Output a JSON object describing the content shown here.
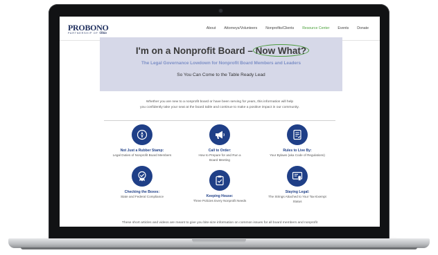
{
  "site": {
    "logo": {
      "main_pro": "PRO",
      "main_bono": "BONO",
      "sub": "PARTNERSHIP OF",
      "sub_ohio": "Ohio"
    },
    "nav": [
      {
        "label": "About"
      },
      {
        "label": "Attorneys/Volunteers"
      },
      {
        "label": "Nonprofits/Clients"
      },
      {
        "label": "Resource Center",
        "active": true
      },
      {
        "label": "Events"
      },
      {
        "label": "Donate"
      }
    ]
  },
  "hero": {
    "title_prefix": "I'm on a Nonprofit Board – ",
    "title_highlight": "Now What?",
    "subtitle": "The Legal Governance Lowdown for Nonprofit Board Members and Leaders",
    "tagline": "So You Can Come to the Table Ready Lead"
  },
  "intro": {
    "line1": "Whether you are new to a nonprofit board or have been serving for years, this information will help",
    "line2": "you confidently take your seat at the board table and continue to make a positive impact in our community."
  },
  "cards": [
    {
      "icon": "compass-icon",
      "title": "Not Just a Rubber Stamp:",
      "desc": "Legal Duties of Nonprofit Board Members"
    },
    {
      "icon": "megaphone-icon",
      "title": "Call to Order:",
      "desc": "How to Prepare for and Run a Board Meeting"
    },
    {
      "icon": "document-icon",
      "title": "Rules to Live By:",
      "desc": "Your Bylaws (aka Code of Regulations)"
    },
    {
      "icon": "badge-check-icon",
      "title": "Checking the Boxes:",
      "desc": "State and Federal Compliance"
    },
    {
      "icon": "clipboard-check-icon",
      "title": "Keeping House:",
      "desc": "Three Policies Every Nonprofit Needs"
    },
    {
      "icon": "certificate-icon",
      "title": "Staying Legal:",
      "desc": "The Strings Attached to Your Tax-Exempt Status"
    }
  ],
  "footer": {
    "text": "These short articles and videos are meant to give you bite-size information on common issues for all board members and nonprofit"
  },
  "colors": {
    "brand_navy": "#1f3f87",
    "accent_green": "#4a9b3c",
    "hero_bg": "#d6d8e8",
    "subtitle_blue": "#7c8fc6"
  }
}
